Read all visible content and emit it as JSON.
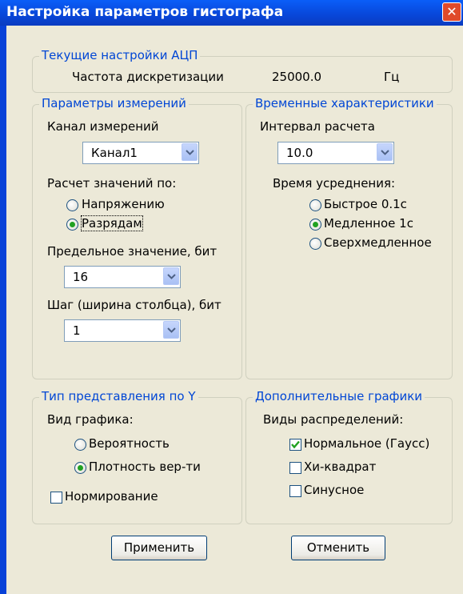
{
  "window": {
    "title": "Настройка параметров гистографа",
    "close_glyph": "✕",
    "title_color": "#0a5ef8"
  },
  "adc": {
    "legend": "Текущие настройки АЦП",
    "label": "Частота дискретизации",
    "value": "25000.0",
    "unit": "Гц"
  },
  "measure": {
    "legend": "Параметры измерений",
    "channel_label": "Канал измерений",
    "channel_value": "Канал1",
    "calc_label": "Расчет значений по:",
    "radio_voltage": "Напряжению",
    "radio_bits": "Разрядам",
    "selected": "Разрядам",
    "limit_label": "Предельное значение, бит",
    "limit_value": "16",
    "step_label": "Шаг (ширина столбца), бит",
    "step_value": "1"
  },
  "timing": {
    "legend": "Временные характеристики",
    "interval_label": "Интервал расчета",
    "interval_value": "10.0",
    "avg_label": "Время усреднения:",
    "radio_fast": "Быстрое 0.1с",
    "radio_slow": "Медленное 1с",
    "radio_ultra": "Сверхмедленное",
    "selected": "Медленное 1с"
  },
  "ytype": {
    "legend": "Тип представления по Y",
    "chart_label": "Вид графика:",
    "radio_prob": "Вероятность",
    "radio_density": "Плотность вер-ти",
    "selected": "Плотность вер-ти",
    "normalize_label": "Нормирование",
    "normalize_checked": false
  },
  "extra": {
    "legend": "Дополнительные графики",
    "dist_label": "Виды распределений:",
    "normal_label": "Нормальное (Гаусс)",
    "normal_checked": true,
    "chi_label": "Хи-квадрат",
    "chi_checked": false,
    "sine_label": "Синусное",
    "sine_checked": false
  },
  "buttons": {
    "apply": "Применить",
    "cancel": "Отменить"
  },
  "colors": {
    "accent": "#0046d5",
    "radio_selected": "#21a121",
    "check_mark": "#21a121"
  }
}
